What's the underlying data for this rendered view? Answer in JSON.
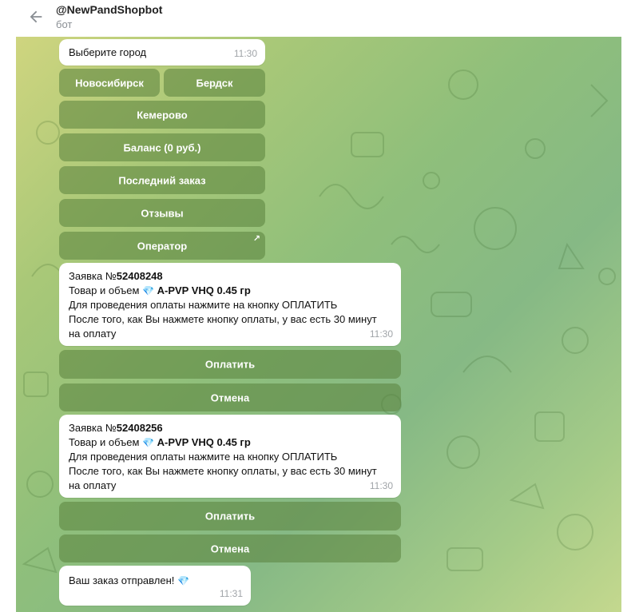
{
  "header": {
    "title": "@NewPandShopbot",
    "subtitle": "бот"
  },
  "messages": {
    "city_prompt": {
      "text": "Выберите город",
      "time": "11:30"
    },
    "city_buttons": {
      "novosibirsk": "Новосибирск",
      "berdsk": "Бердск",
      "kemerovo": "Кемерово",
      "balance": "Баланс (0 руб.)",
      "last_order": "Последний заказ",
      "reviews": "Отзывы",
      "operator": "Оператор",
      "operator_link_icon": "↗"
    },
    "order1": {
      "prefix": "Заявка №",
      "number": "52408248",
      "product_label": "Товар и объем",
      "gem_icon": "💎",
      "product": "A-PVP VHQ 0.45 гр",
      "line3": "Для проведения оплаты нажмите на кнопку ОПЛАТИТЬ",
      "line4": "После того, как Вы нажмете кнопку оплаты, у вас есть 30 минут",
      "line5": "на оплату",
      "time": "11:30",
      "pay_button": "Оплатить",
      "cancel_button": "Отмена"
    },
    "order2": {
      "prefix": "Заявка №",
      "number": "52408256",
      "product_label": "Товар и объем",
      "gem_icon": "💎",
      "product": "A-PVP VHQ 0.45 гр",
      "line3": "Для проведения оплаты нажмите на кнопку ОПЛАТИТЬ",
      "line4": "После того, как Вы нажмете кнопку оплаты, у вас есть 30 минут",
      "line5": "на оплату",
      "time": "11:30",
      "pay_button": "Оплатить",
      "cancel_button": "Отмена"
    },
    "sent": {
      "text": "Ваш заказ отправлен!",
      "gem_icon": "💎",
      "time": "11:31"
    }
  },
  "colors": {
    "button_bg": "#6a9450",
    "time_text": "#a0a4a8",
    "gem": "#3aa8e8"
  }
}
